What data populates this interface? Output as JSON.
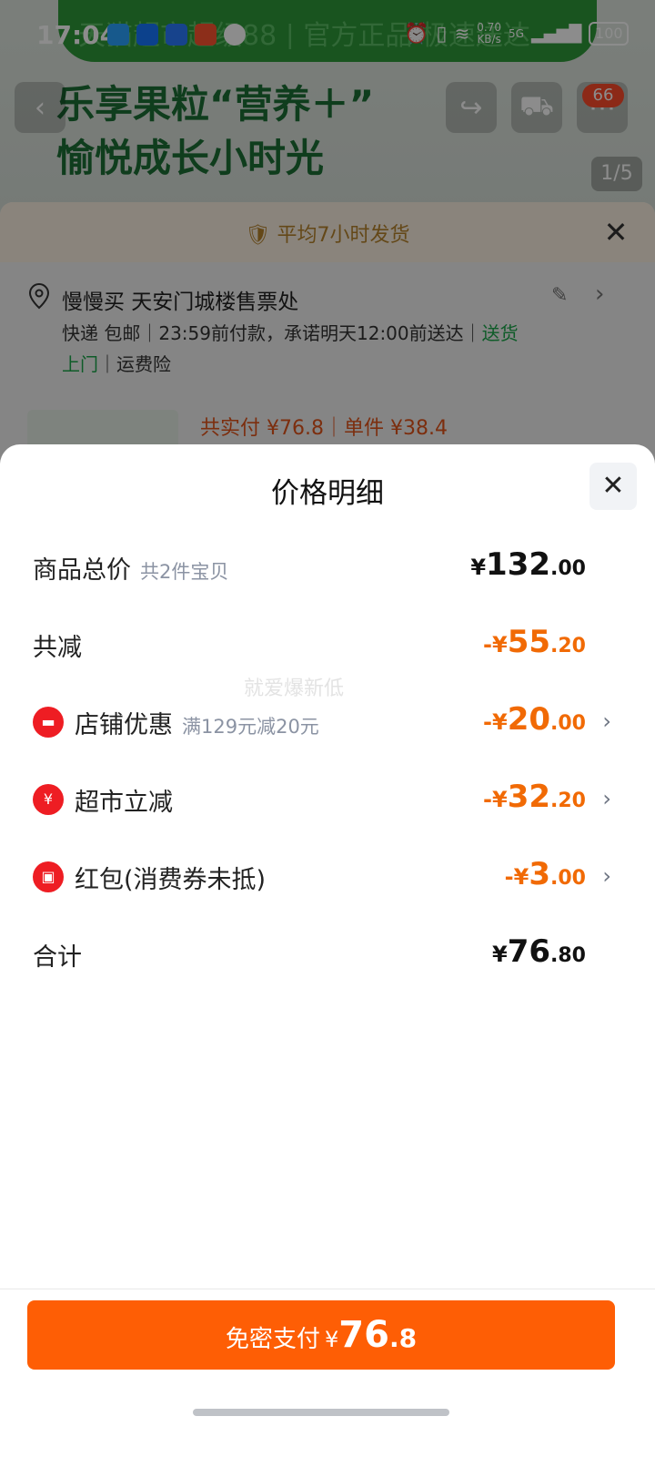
{
  "status_bar": {
    "time": "17:04",
    "speed": "0.70",
    "speed_unit": "KB/s",
    "network": "5G",
    "battery": "100"
  },
  "background_page": {
    "banner_text": "天猫超市超级88 | 官方正品 极速送达",
    "hero_title": "乐享果粒“营养＋”",
    "hero_subtitle": "愉悦成长小时光",
    "cart_badge": "66",
    "image_pager": "1/5",
    "shipping_note": "平均7小时发货",
    "address": "慢慢买 天安门城楼售票处",
    "delivery_line1_plain": "快递 包邮｜23:59前付款，承诺明天12:00前送达｜",
    "delivery_line1_green": "送货",
    "delivery_line2_green": "上门",
    "delivery_line2_plain": "｜运费险",
    "product_price_text": "共实付 ¥76.8｜单件 ¥38.4"
  },
  "price_detail": {
    "title": "价格明细",
    "watermark": "就爱爆新低",
    "rows": [
      {
        "label": "商品总价",
        "sub": "共2件宝贝",
        "sign": "",
        "cur": "¥",
        "int": "132",
        "dec": ".00",
        "color": "black",
        "icon": "",
        "chevron": false
      },
      {
        "label": "共减",
        "sub": "",
        "sign": "-",
        "cur": "¥",
        "int": "55",
        "dec": ".20",
        "color": "orange",
        "icon": "",
        "chevron": false
      },
      {
        "label": "店铺优惠",
        "sub": "满129元减20元",
        "sign": "-",
        "cur": "¥",
        "int": "20",
        "dec": ".00",
        "color": "orange",
        "icon": "store-icon",
        "chevron": true
      },
      {
        "label": "超市立减",
        "sub": "",
        "sign": "-",
        "cur": "¥",
        "int": "32",
        "dec": ".20",
        "color": "orange",
        "icon": "yen-coin-icon",
        "chevron": true
      },
      {
        "label": "红包(消费券未抵)",
        "sub": "",
        "sign": "-",
        "cur": "¥",
        "int": "3",
        "dec": ".00",
        "color": "orange",
        "icon": "red-packet-icon",
        "chevron": true
      },
      {
        "label": "合计",
        "sub": "",
        "sign": "",
        "cur": "¥",
        "int": "76",
        "dec": ".80",
        "color": "black",
        "icon": "",
        "chevron": false
      }
    ]
  },
  "pay_button": {
    "label": "免密支付",
    "cur": "¥",
    "int": "76",
    "dec": ".8"
  },
  "colors": {
    "accent_orange": "#fe5e05",
    "discount_orange": "#f16a05",
    "icon_red": "#ee1d23",
    "brand_green": "#2f9a3a"
  }
}
